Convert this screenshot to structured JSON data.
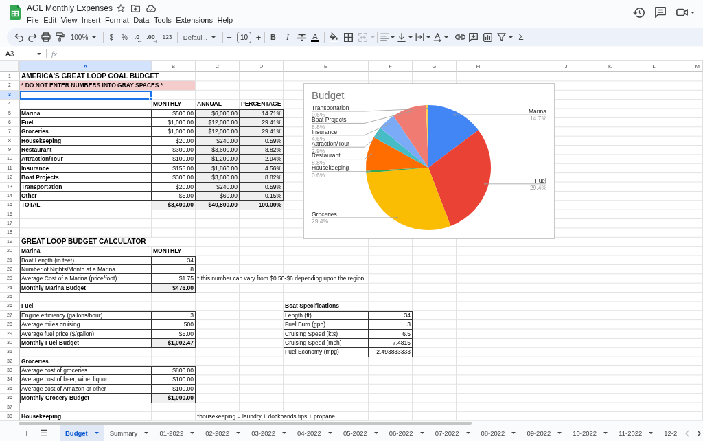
{
  "title_bar": {
    "document_title": "AGL Monthly Expenses"
  },
  "menu": [
    "File",
    "Edit",
    "View",
    "Insert",
    "Format",
    "Data",
    "Tools",
    "Extensions",
    "Help"
  ],
  "toolbar": {
    "zoom": "100%",
    "currency": "$",
    "percent": "%",
    "decrease_decimals": ".0",
    "increase_decimals": ".00",
    "number_format": "123",
    "font": "Defaul...",
    "decrease_font_size": "−",
    "font_size": "10",
    "increase_font_size": "+",
    "bold": "B",
    "italic": "I",
    "text_color": "A",
    "merge_disabled": true,
    "functions": "Σ"
  },
  "formula_bar": {
    "name_box": "A3",
    "fx": "fx"
  },
  "columns": [
    {
      "label": "A",
      "selected": true
    },
    {
      "label": "B",
      "selected": false
    },
    {
      "label": "C",
      "selected": false
    },
    {
      "label": "D",
      "selected": false
    },
    {
      "label": "E",
      "selected": false
    },
    {
      "label": "F",
      "selected": false
    },
    {
      "label": "G",
      "selected": false
    },
    {
      "label": "H",
      "selected": false
    },
    {
      "label": "I",
      "selected": false
    },
    {
      "label": "J",
      "selected": false
    },
    {
      "label": "K",
      "selected": false
    },
    {
      "label": "L",
      "selected": false
    },
    {
      "label": "M",
      "selected": false
    }
  ],
  "row_numbers": [
    {
      "label": "1",
      "selected": false
    },
    {
      "label": "2",
      "selected": false
    },
    {
      "label": "3",
      "selected": true
    },
    {
      "label": "4",
      "selected": false
    },
    {
      "label": "5",
      "selected": false
    },
    {
      "label": "6",
      "selected": false
    },
    {
      "label": "7",
      "selected": false
    },
    {
      "label": "8",
      "selected": false
    },
    {
      "label": "9",
      "selected": false
    },
    {
      "label": "10",
      "selected": false
    },
    {
      "label": "11",
      "selected": false
    },
    {
      "label": "12",
      "selected": false
    },
    {
      "label": "13",
      "selected": false
    },
    {
      "label": "14",
      "selected": false
    },
    {
      "label": "15",
      "selected": false
    },
    {
      "label": "16",
      "selected": false
    },
    {
      "label": "17",
      "selected": false
    },
    {
      "label": "18",
      "selected": false
    },
    {
      "label": "19",
      "selected": false
    },
    {
      "label": "20",
      "selected": false
    },
    {
      "label": "21",
      "selected": false
    },
    {
      "label": "22",
      "selected": false
    },
    {
      "label": "23",
      "selected": false
    },
    {
      "label": "24",
      "selected": false
    },
    {
      "label": "25",
      "selected": false
    },
    {
      "label": "26",
      "selected": false
    },
    {
      "label": "27",
      "selected": false
    },
    {
      "label": "28",
      "selected": false
    },
    {
      "label": "29",
      "selected": false
    },
    {
      "label": "30",
      "selected": false
    },
    {
      "label": "31",
      "selected": false
    },
    {
      "label": "32",
      "selected": false
    },
    {
      "label": "33",
      "selected": false
    },
    {
      "label": "34",
      "selected": false
    },
    {
      "label": "35",
      "selected": false
    },
    {
      "label": "36",
      "selected": false
    },
    {
      "label": "37",
      "selected": false
    },
    {
      "label": "38",
      "selected": false
    }
  ],
  "budget": {
    "title": "AMERICA'S GREAT LOOP GOAL BUDGET",
    "note": "* DO NOT ENTER NUMBERS INTO GRAY SPACES *",
    "columns": [
      "MONTHLY",
      "ANNUAL",
      "PERCENTAGE"
    ],
    "rows": [
      {
        "category": "Marina",
        "monthly": "$500.00",
        "annual": "$6,000.00",
        "percentage": "14.71%"
      },
      {
        "category": "Fuel",
        "monthly": "$1,000.00",
        "annual": "$12,000.00",
        "percentage": "29.41%"
      },
      {
        "category": "Groceries",
        "monthly": "$1,000.00",
        "annual": "$12,000.00",
        "percentage": "29.41%"
      },
      {
        "category": "Housekeeping",
        "monthly": "$20.00",
        "annual": "$240.00",
        "percentage": "0.59%"
      },
      {
        "category": "Restaurant",
        "monthly": "$300.00",
        "annual": "$3,600.00",
        "percentage": "8.82%"
      },
      {
        "category": "Attraction/Tour",
        "monthly": "$100.00",
        "annual": "$1,200.00",
        "percentage": "2.94%"
      },
      {
        "category": "Insurance",
        "monthly": "$155.00",
        "annual": "$1,860.00",
        "percentage": "4.56%"
      },
      {
        "category": "Boat Projects",
        "monthly": "$300.00",
        "annual": "$3,600.00",
        "percentage": "8.82%"
      },
      {
        "category": "Transportation",
        "monthly": "$20.00",
        "annual": "$240.00",
        "percentage": "0.59%"
      },
      {
        "category": "Other",
        "monthly": "$5.00",
        "annual": "$60.00",
        "percentage": "0.15%"
      }
    ],
    "total": {
      "label": "TOTAL",
      "monthly": "$3,400.00",
      "annual": "$40,800.00",
      "percentage": "100.00%"
    }
  },
  "chart": {
    "chart_data": {
      "type": "pie",
      "title": "Budget",
      "categories": [
        "Marina",
        "Fuel",
        "Groceries",
        "Housekeeping",
        "Restaurant",
        "Attraction/Tour",
        "Insurance",
        "Boat Projects",
        "Transportation"
      ],
      "values": [
        14.71,
        29.41,
        29.41,
        0.59,
        8.82,
        2.94,
        4.56,
        8.82,
        0.59
      ],
      "value_labels": [
        "14.7%",
        "29.4%",
        "29.4%",
        "0.6%",
        "8.8%",
        "2.9%",
        "4.6%",
        "8.8%",
        "0.6%"
      ]
    }
  },
  "calculator": {
    "title": "GREAT LOOP BUDGET CALCULATOR",
    "sections": [
      {
        "heading": "Marina",
        "column": "MONTHLY",
        "rows": [
          {
            "label": "Boat Length (in feet)",
            "value": "34"
          },
          {
            "label": "Number of Nights/Month at a Marina",
            "value": "8"
          },
          {
            "label": "Average Cost of a Marina (price/foot)",
            "value": "$1.75",
            "note": "* this number can vary from $0.50-$6 depending upon the region"
          }
        ],
        "total": {
          "label": "Monthly Marina Budget",
          "value": "$476.00"
        }
      },
      {
        "heading": "Fuel",
        "rows": [
          {
            "label": "Engine efficiency (gallons/hour)",
            "value": "3"
          },
          {
            "label": "Average miles cruising",
            "value": "500"
          },
          {
            "label": "Average fuel price ($/gallon)",
            "value": "$5.00"
          }
        ],
        "total": {
          "label": "Monthly Fuel Budget",
          "value": "$1,002.47"
        }
      },
      {
        "heading": "Groceries",
        "rows": [
          {
            "label": "Average cost of groceries",
            "value": "$800.00"
          },
          {
            "label": "Average cost of beer, wine, liquor",
            "value": "$100.00"
          },
          {
            "label": "Average cost of Amazon or other",
            "value": "$100.00"
          }
        ],
        "total": {
          "label": "Monthly Grocery Budget",
          "value": "$1,000.00"
        }
      },
      {
        "heading": "Housekeeping",
        "note": "*housekeeping = laundry + dockhands tips + propane"
      }
    ]
  },
  "boat_specifications": {
    "title": "Boat Specifications",
    "rows": [
      {
        "label": "Length (ft)",
        "value": "34"
      },
      {
        "label": "Fuel Burn (gph)",
        "value": "3"
      },
      {
        "label": "Cruising Speed (kts)",
        "value": "6.5"
      },
      {
        "label": "Cruising Speed (mph)",
        "value": "7.4815"
      },
      {
        "label": "Fuel Economy (mpg)",
        "value": "2.493833333"
      }
    ]
  },
  "tab_bar": {
    "add_sheet": "+",
    "all_sheets": "☰"
  },
  "sheet_tabs": [
    {
      "label": "Budget",
      "selected": true
    },
    {
      "label": "Summary",
      "selected": false
    },
    {
      "label": "01-2022",
      "selected": false
    },
    {
      "label": "02-2022",
      "selected": false
    },
    {
      "label": "03-2022",
      "selected": false
    },
    {
      "label": "04-2022",
      "selected": false
    },
    {
      "label": "05-2022",
      "selected": false
    },
    {
      "label": "06-2022",
      "selected": false
    },
    {
      "label": "07-2022",
      "selected": false
    },
    {
      "label": "08-2022",
      "selected": false
    },
    {
      "label": "09-2022",
      "selected": false
    },
    {
      "label": "10-2022",
      "selected": false
    },
    {
      "label": "11-2022",
      "selected": false
    },
    {
      "label": "12-2",
      "selected": false
    }
  ],
  "tab_navigation": {
    "previous_disabled": true,
    "next_disabled": false
  }
}
